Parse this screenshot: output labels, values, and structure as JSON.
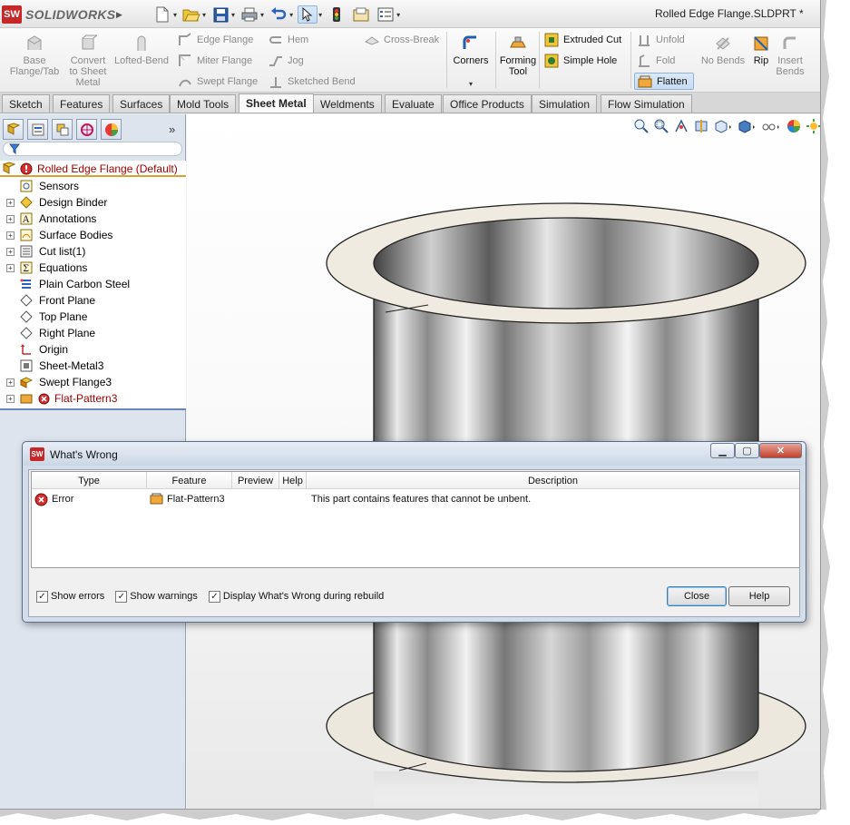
{
  "app": {
    "logo_text": "SOLIDWORKS",
    "logo_mark": "SW",
    "document_title": "Rolled Edge Flange.SLDPRT *"
  },
  "quick_access": [
    {
      "name": "new-icon"
    },
    {
      "name": "open-icon"
    },
    {
      "name": "save-icon"
    },
    {
      "name": "print-icon"
    },
    {
      "name": "undo-icon"
    },
    {
      "name": "select-icon"
    },
    {
      "name": "rebuild-icon"
    },
    {
      "name": "file-properties-icon"
    },
    {
      "name": "options-icon"
    }
  ],
  "commands": {
    "base_flange": "Base Flange/Tab",
    "convert": "Convert to Sheet Metal",
    "lofted_bend": "Lofted-Bend",
    "edge_flange": "Edge Flange",
    "miter_flange": "Miter Flange",
    "swept_flange": "Swept Flange",
    "hem": "Hem",
    "jog": "Jog",
    "sketched_bend": "Sketched Bend",
    "cross_break": "Cross-Break",
    "corners": "Corners",
    "forming_tool": "Forming Tool",
    "extruded_cut": "Extruded Cut",
    "simple_hole": "Simple Hole",
    "unfold": "Unfold",
    "fold": "Fold",
    "flatten": "Flatten",
    "no_bends": "No Bends",
    "rip": "Rip",
    "insert_bends": "Insert Bends"
  },
  "tabs": [
    "Sketch",
    "Features",
    "Surfaces",
    "Mold Tools",
    "Sheet Metal",
    "Weldments",
    "Evaluate",
    "Office Products",
    "Simulation",
    "Flow Simulation"
  ],
  "active_tab": "Sheet Metal",
  "tree": {
    "root": "Rolled Edge Flange  (Default)",
    "items": [
      {
        "label": "Sensors",
        "expand": false
      },
      {
        "label": "Design Binder",
        "expand": true
      },
      {
        "label": "Annotations",
        "expand": true
      },
      {
        "label": "Surface Bodies",
        "expand": true
      },
      {
        "label": "Cut list(1)",
        "expand": true
      },
      {
        "label": "Equations",
        "expand": true
      },
      {
        "label": "Plain Carbon Steel",
        "expand": false
      },
      {
        "label": "Front Plane",
        "expand": false
      },
      {
        "label": "Top Plane",
        "expand": false
      },
      {
        "label": "Right Plane",
        "expand": false
      },
      {
        "label": "Origin",
        "expand": false
      },
      {
        "label": "Sheet-Metal3",
        "expand": false
      },
      {
        "label": "Swept Flange3",
        "expand": true
      },
      {
        "label": "Flat-Pattern3",
        "expand": true
      }
    ]
  },
  "dialog": {
    "title": "What's Wrong",
    "columns": [
      "Type",
      "Feature",
      "Preview",
      "Help",
      "Description"
    ],
    "rows": [
      {
        "type": "Error",
        "feature": "Flat-Pattern3",
        "preview": "",
        "help": "",
        "description": "This part contains features that cannot be unbent."
      }
    ],
    "options": {
      "show_errors": "Show errors",
      "show_warnings": "Show warnings",
      "display_during_rebuild": "Display What's Wrong during rebuild"
    },
    "close_label": "Close",
    "help_label": "Help"
  }
}
